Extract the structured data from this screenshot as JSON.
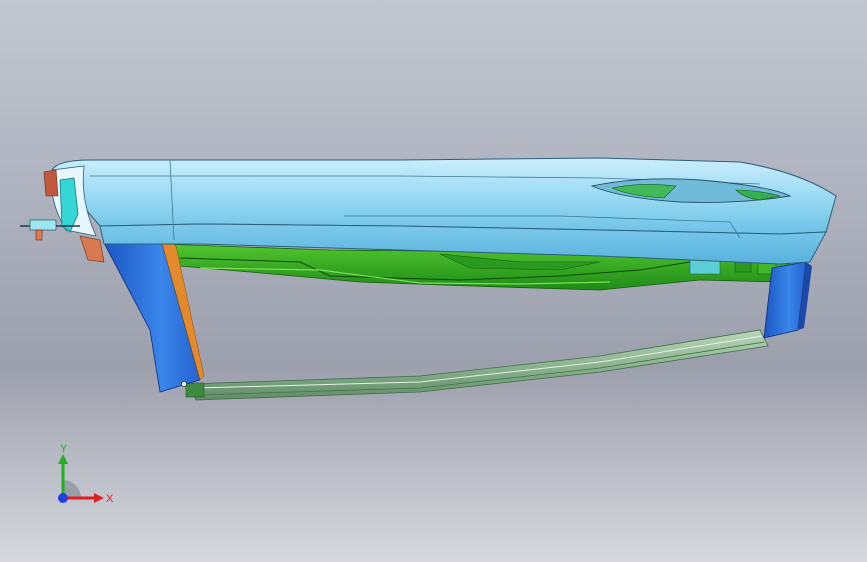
{
  "viewport": {
    "background_top": "#c3c7d1",
    "background_bottom": "#d6d8de"
  },
  "model": {
    "parts": [
      {
        "name": "hood-outer-panel",
        "color": "#8fd2ee"
      },
      {
        "name": "inner-reinforcement-frame",
        "color": "#2fae1e"
      },
      {
        "name": "left-hinge-bracket",
        "color": "#2a6fd6"
      },
      {
        "name": "right-hinge-bracket",
        "color": "#2a6fd6"
      },
      {
        "name": "rear-seal-strip",
        "color": "#7da883"
      },
      {
        "name": "washer-nozzle-assembly",
        "color": "#35d6d6"
      }
    ]
  },
  "triad": {
    "x_label": "X",
    "y_label": "Y",
    "x_color": "#e02020",
    "y_color": "#20b020",
    "z_color": "#2040e0",
    "icon": "coordinate-triad-icon"
  }
}
